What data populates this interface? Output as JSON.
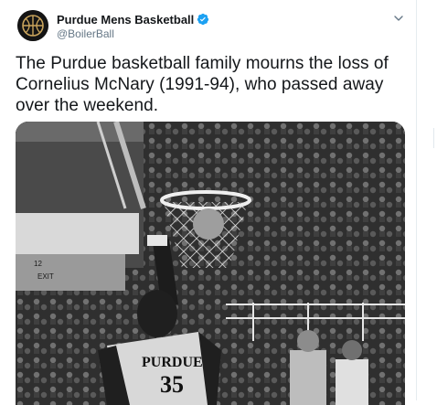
{
  "tweet": {
    "display_name": "Purdue Mens Basketball",
    "handle": "@BoilerBall",
    "verified": true,
    "text": "The Purdue basketball family mourns the loss of Cornelius McNary (1991-94), who passed away over the weekend.",
    "menu_icon": "chevron-down-icon"
  },
  "avatar": {
    "icon": "basketball-logo-icon",
    "accent": "#c9a45c"
  },
  "media": {
    "sign_12": "12",
    "sign_exit": "EXIT",
    "jersey_text": "PURDUE",
    "jersey_number": "35"
  },
  "colors": {
    "verified_blue": "#1da1f2",
    "text_primary": "#14171a",
    "text_secondary": "#657786"
  }
}
